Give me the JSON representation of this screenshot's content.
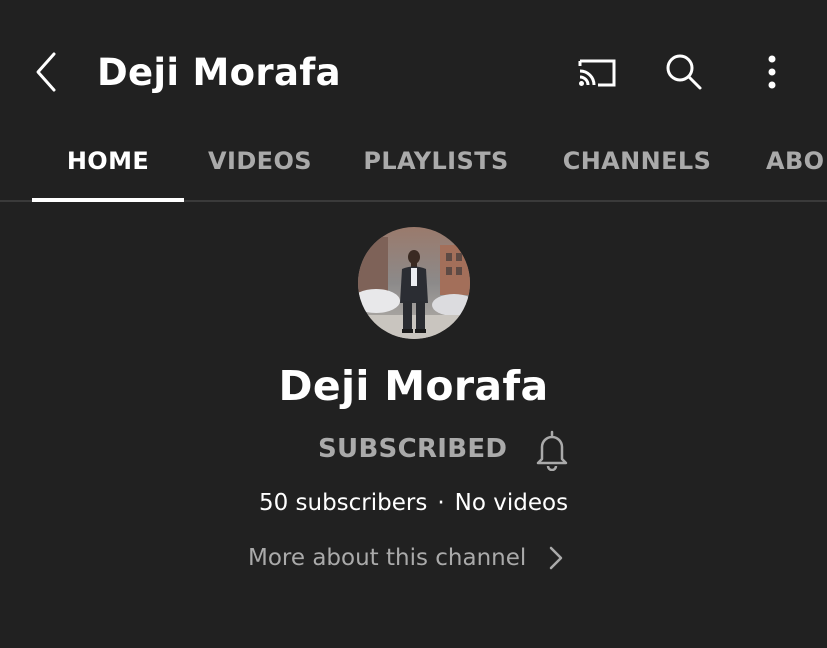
{
  "header": {
    "title": "Deji Morafa",
    "icons": {
      "back": "chevron-left-icon",
      "cast": "cast-icon",
      "search": "search-icon",
      "more": "more-vertical-icon"
    }
  },
  "tabs": [
    {
      "label": "HOME",
      "active": true
    },
    {
      "label": "VIDEOS",
      "active": false
    },
    {
      "label": "PLAYLISTS",
      "active": false
    },
    {
      "label": "CHANNELS",
      "active": false
    },
    {
      "label": "ABO",
      "active": false
    }
  ],
  "channel": {
    "name": "Deji Morafa",
    "subscribe_label": "SUBSCRIBED",
    "subscribers": "50 subscribers",
    "separator": "·",
    "videos": "No videos",
    "more_about": "More about this channel"
  },
  "colors": {
    "background": "#212121",
    "text_primary": "#ffffff",
    "text_secondary": "#aaaaaa",
    "divider": "#3a3a3a"
  }
}
